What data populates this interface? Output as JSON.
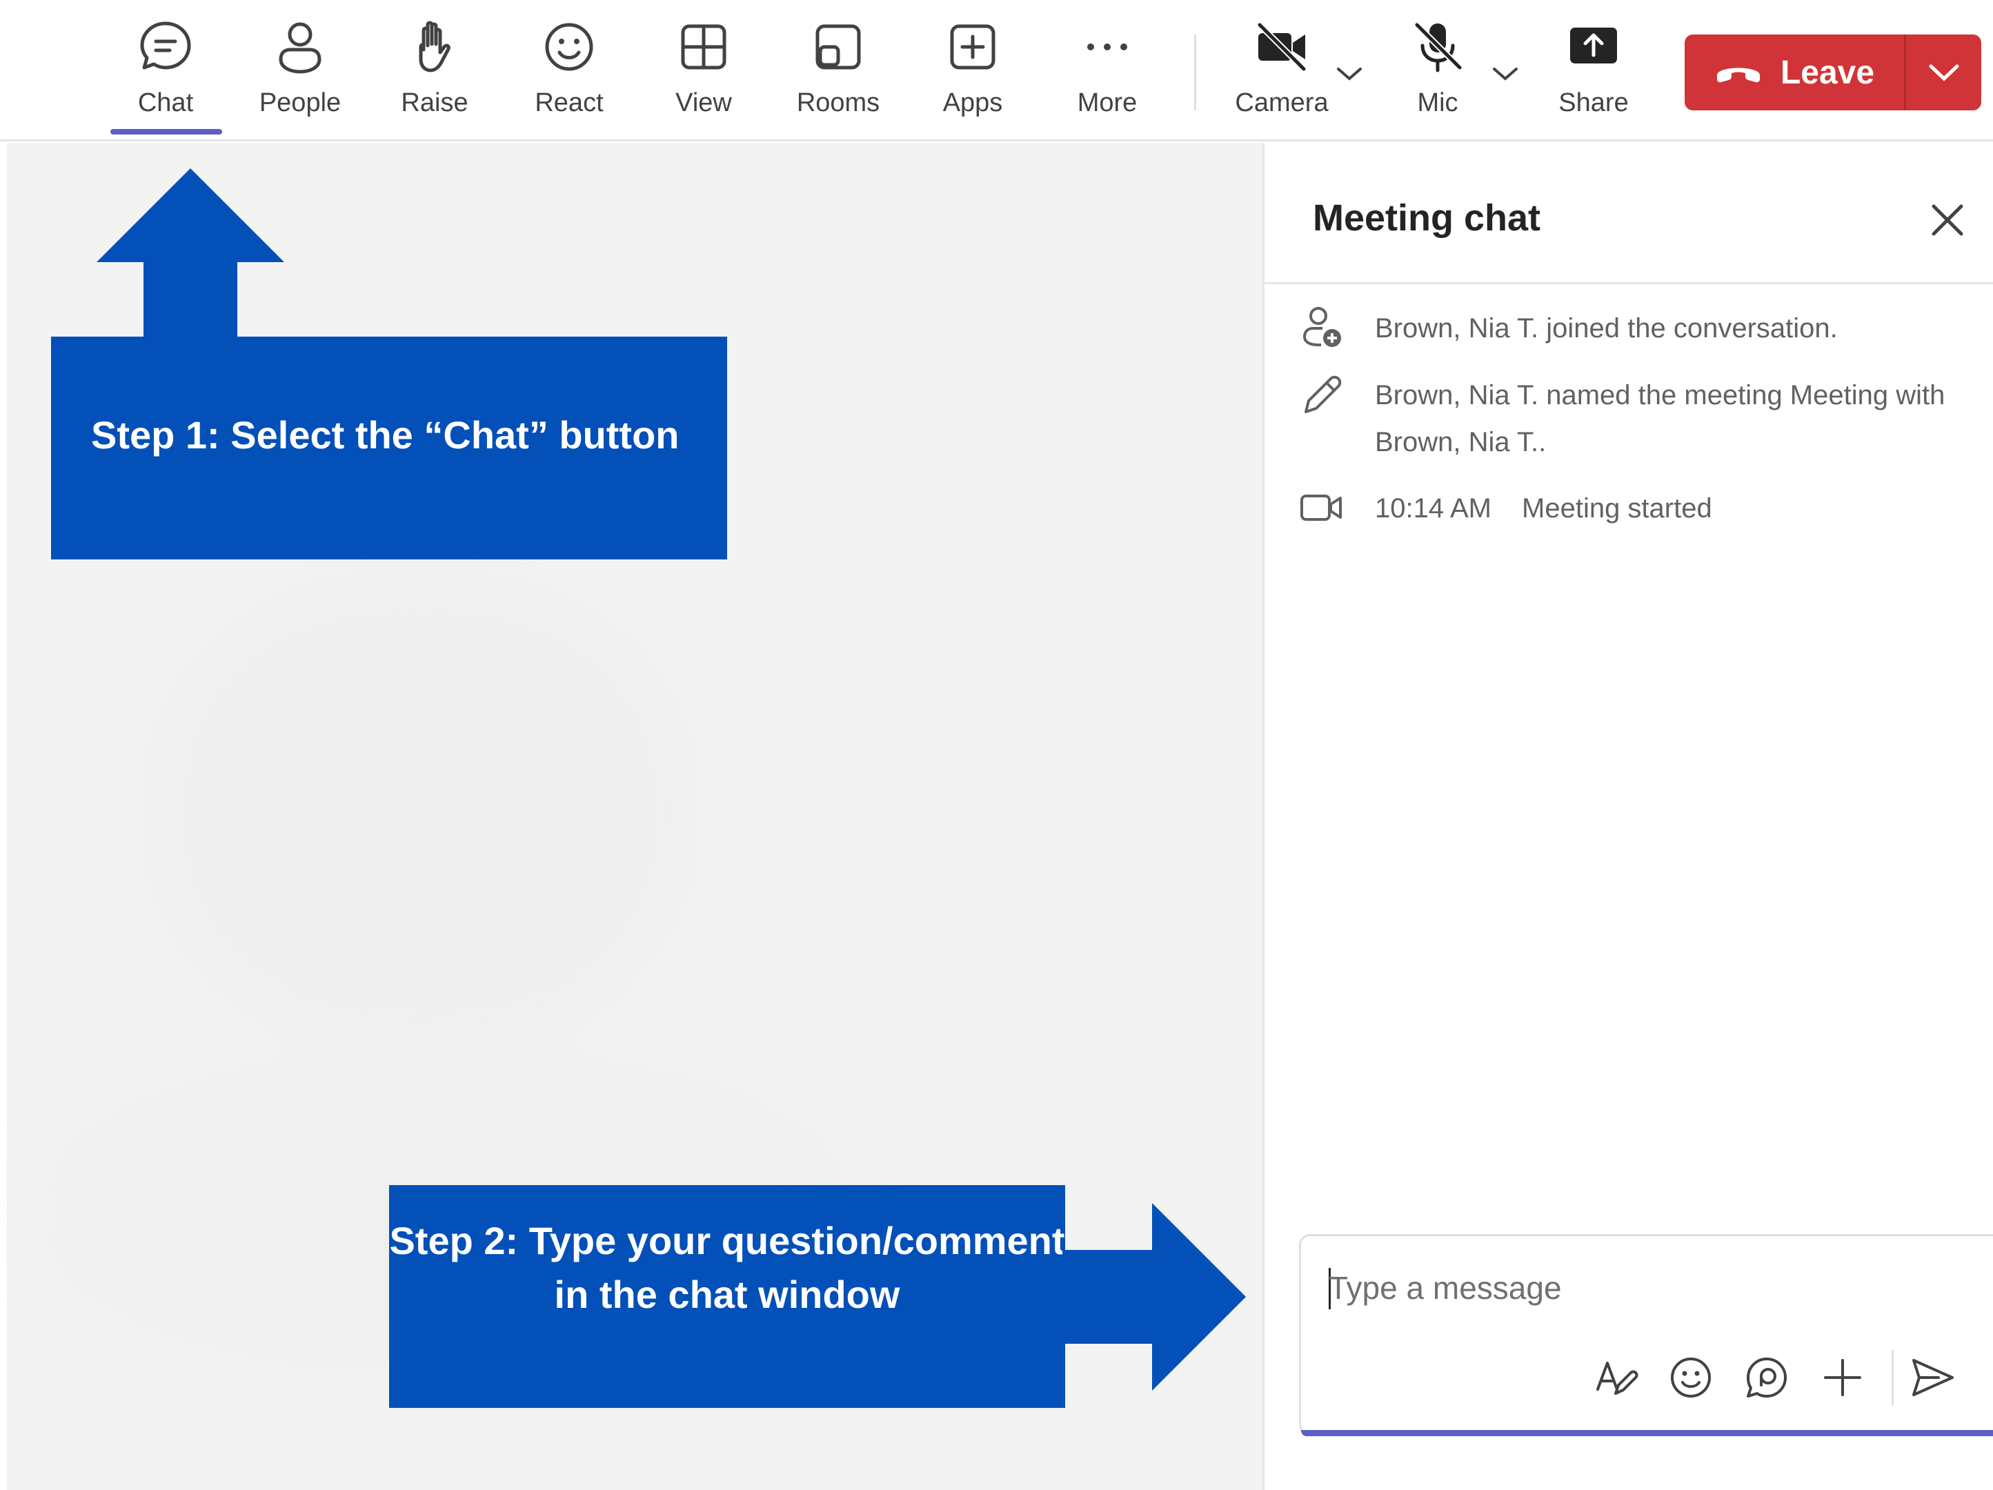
{
  "toolbar": {
    "chat": {
      "label": "Chat",
      "icon": "chat-bubble-icon"
    },
    "people": {
      "label": "People",
      "icon": "person-icon"
    },
    "raise": {
      "label": "Raise",
      "icon": "hand-icon"
    },
    "react": {
      "label": "React",
      "icon": "smiley-icon"
    },
    "view": {
      "label": "View",
      "icon": "grid-icon"
    },
    "rooms": {
      "label": "Rooms",
      "icon": "rooms-icon"
    },
    "apps": {
      "label": "Apps",
      "icon": "plus-square-icon"
    },
    "more": {
      "label": "More",
      "icon": "ellipsis-icon"
    },
    "camera": {
      "label": "Camera",
      "icon": "camera-off-icon"
    },
    "mic": {
      "label": "Mic",
      "icon": "mic-off-icon"
    },
    "share": {
      "label": "Share",
      "icon": "share-tray-icon"
    },
    "leave": {
      "label": "Leave",
      "icon": "phone-hangup-icon"
    }
  },
  "chat_panel": {
    "title": "Meeting chat",
    "events": [
      {
        "icon": "person-add-icon",
        "text": "Brown, Nia T. joined the conversation."
      },
      {
        "icon": "pencil-icon",
        "text": "Brown, Nia T. named the meeting Meeting with Brown, Nia T.."
      },
      {
        "icon": "video-icon",
        "time": "10:14 AM",
        "text": "Meeting started"
      }
    ],
    "compose": {
      "placeholder": "Type a message",
      "buttons": [
        "format-icon",
        "emoji-icon",
        "loop-icon",
        "attach-plus-icon",
        "send-icon"
      ]
    }
  },
  "callouts": {
    "step1": "Step 1: Select the “Chat” button",
    "step2": "Step 2: Type your question/comment in the chat window"
  },
  "colors": {
    "accent": "#5b5fc7",
    "leave": "#d13438",
    "callout": "#0350b8",
    "stage": "#f3f3f3"
  }
}
